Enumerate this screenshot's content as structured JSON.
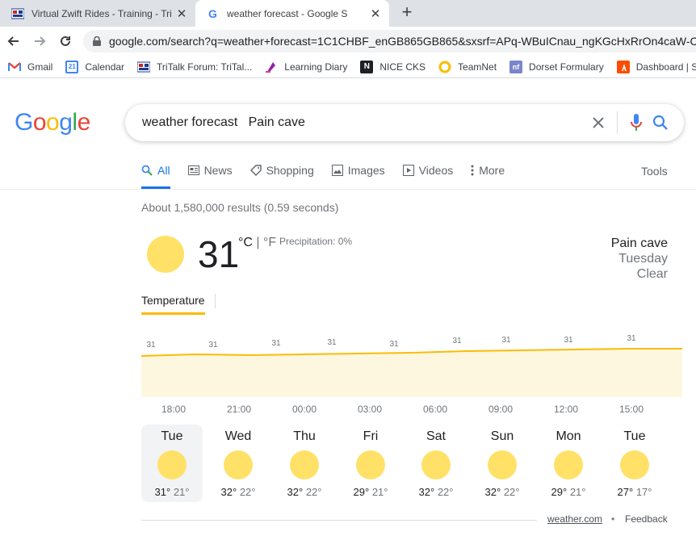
{
  "browser": {
    "tabs": [
      {
        "title": "Virtual Zwift Rides - Training - Tri",
        "favicon": "tritalk-icon"
      },
      {
        "title": "weather forecast      - Google S",
        "favicon": "google-icon"
      }
    ],
    "url": "google.com/search?q=weather+forecast=1C1CHBF_enGB865GB865&sxsrf=APq-WBuICnau_ngKGcHxRrOn4caW-CCQ"
  },
  "bookmarks": [
    {
      "label": "Gmail",
      "icon": "gmail-icon",
      "color": "#ea4335"
    },
    {
      "label": "Calendar",
      "icon": "calendar-icon",
      "color": "#4285f4"
    },
    {
      "label": "TriTalk Forum: TriTal...",
      "icon": "tritalk-icon",
      "color": "#c62828"
    },
    {
      "label": "Learning Diary",
      "icon": "learning-diary-icon",
      "color": "#8e24aa"
    },
    {
      "label": "NICE CKS",
      "icon": "nice-icon",
      "color": "#202124"
    },
    {
      "label": "TeamNet",
      "icon": "teamnet-icon",
      "color": "#fbbc04"
    },
    {
      "label": "Dorset Formulary",
      "icon": "formulary-icon",
      "color": "#5c6bc0"
    },
    {
      "label": "Dashboard | Strav",
      "icon": "strava-icon",
      "color": "#fc4c02"
    }
  ],
  "search": {
    "query": "weather forecast   Pain cave"
  },
  "nav_tabs": [
    {
      "label": "All",
      "icon": "search-icon",
      "active": true
    },
    {
      "label": "News",
      "icon": "news-icon",
      "active": false
    },
    {
      "label": "Shopping",
      "icon": "shopping-tag-icon",
      "active": false
    },
    {
      "label": "Images",
      "icon": "images-icon",
      "active": false
    },
    {
      "label": "Videos",
      "icon": "videos-icon",
      "active": false
    },
    {
      "label": "More",
      "icon": "more-icon",
      "active": false
    }
  ],
  "tools_label": "Tools",
  "result_stats": "About 1,580,000 results (0.59 seconds)",
  "weather": {
    "temperature": "31",
    "unit_c": "°C",
    "unit_sep": "|",
    "unit_f": "°F",
    "precipitation": "Precipitation: 0%",
    "location": "Pain cave",
    "day": "Tuesday",
    "condition": "Clear",
    "tab_label": "Temperature",
    "sun_color": "#ffe168",
    "chart_fill": "#fef7e0",
    "chart_line": "#fbbc04"
  },
  "chart_data": {
    "type": "area",
    "x": [
      "18:00",
      "21:00",
      "00:00",
      "03:00",
      "06:00",
      "09:00",
      "12:00",
      "15:00"
    ],
    "values": [
      31,
      31,
      31,
      31,
      31,
      31,
      31,
      31
    ],
    "labels": [
      "31",
      "31",
      "31",
      "31",
      "31",
      "31",
      "31",
      "31",
      "31",
      "31"
    ],
    "x_tick_labels": [
      "18:00",
      "21:00",
      "00:00",
      "03:00",
      "06:00",
      "09:00",
      "12:00",
      "15:00"
    ]
  },
  "daily": [
    {
      "day": "Tue",
      "high": "31°",
      "low": "21°",
      "selected": true
    },
    {
      "day": "Wed",
      "high": "32°",
      "low": "22°",
      "selected": false
    },
    {
      "day": "Thu",
      "high": "32°",
      "low": "22°",
      "selected": false
    },
    {
      "day": "Fri",
      "high": "29°",
      "low": "21°",
      "selected": false
    },
    {
      "day": "Sat",
      "high": "32°",
      "low": "22°",
      "selected": false
    },
    {
      "day": "Sun",
      "high": "32°",
      "low": "22°",
      "selected": false
    },
    {
      "day": "Mon",
      "high": "29°",
      "low": "21°",
      "selected": false
    },
    {
      "day": "Tue",
      "high": "27°",
      "low": "17°",
      "selected": false
    }
  ],
  "footer": {
    "source": "weather.com",
    "separator": "•",
    "feedback": "Feedback"
  }
}
